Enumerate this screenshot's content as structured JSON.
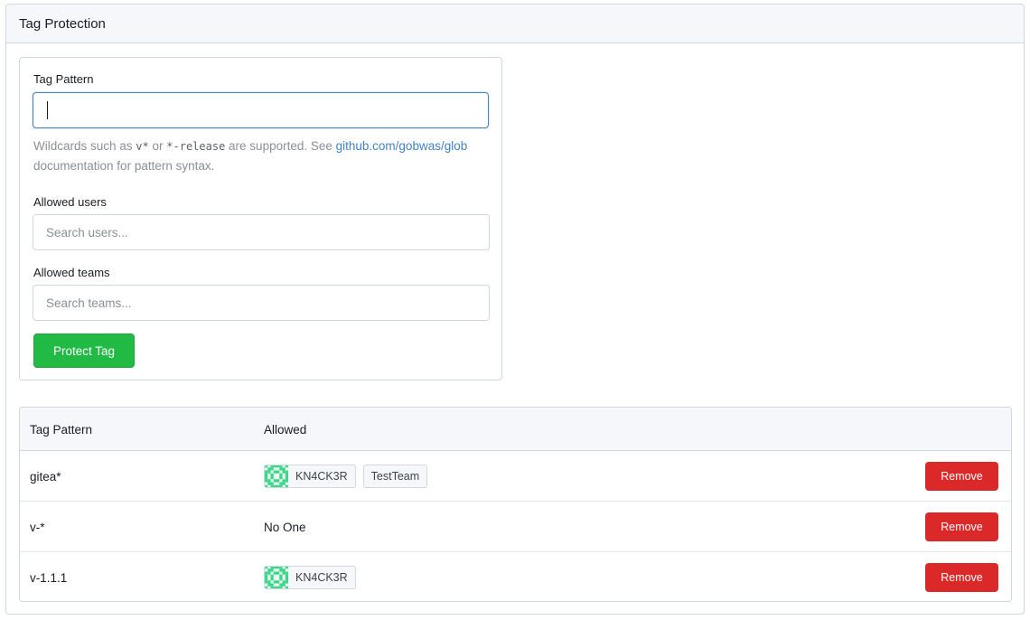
{
  "header": {
    "title": "Tag Protection"
  },
  "form": {
    "tag_pattern_label": "Tag Pattern",
    "tag_pattern_value": "",
    "help_prefix": "Wildcards such as ",
    "help_code1": "v*",
    "help_or": " or ",
    "help_code2": "*-release",
    "help_mid": " are supported. See ",
    "help_link": "github.com/gobwas/glob",
    "help_suffix": " documentation for pattern syntax.",
    "allowed_users_label": "Allowed users",
    "allowed_users_placeholder": "Search users...",
    "allowed_teams_label": "Allowed teams",
    "allowed_teams_placeholder": "Search teams...",
    "submit_label": "Protect Tag"
  },
  "table": {
    "col_pattern": "Tag Pattern",
    "col_allowed": "Allowed",
    "rows": [
      {
        "pattern": "gitea*",
        "user": "KN4CK3R",
        "team": "TestTeam",
        "remove": "Remove"
      },
      {
        "pattern": "v-*",
        "none": "No One",
        "remove": "Remove"
      },
      {
        "pattern": "v-1.1.1",
        "user": "KN4CK3R",
        "remove": "Remove"
      }
    ]
  },
  "colors": {
    "primary": "#21ba45",
    "danger": "#db2828",
    "link": "#4183c4",
    "avatar": "#3cd68a"
  }
}
